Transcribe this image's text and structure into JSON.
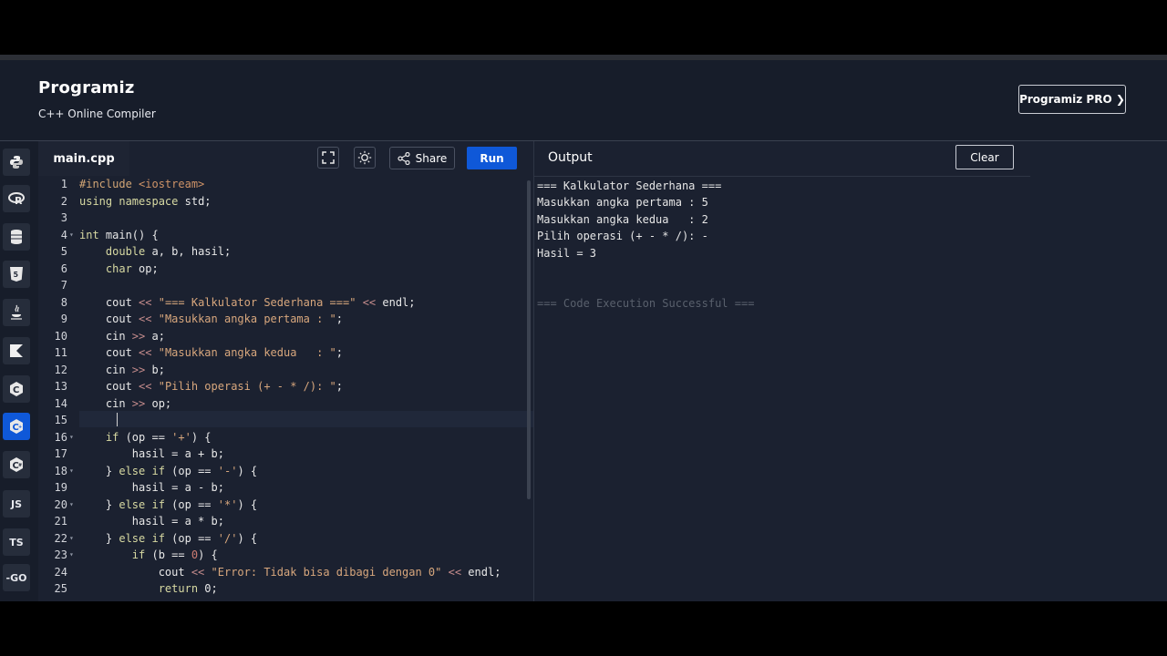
{
  "header": {
    "logo": "Programiz",
    "subtitle": "C++ Online Compiler",
    "pro_button": "Programiz PRO ❯"
  },
  "sidebar": {
    "languages": [
      {
        "name": "python-icon",
        "label": ""
      },
      {
        "name": "r-icon",
        "label": ""
      },
      {
        "name": "sql-icon",
        "label": ""
      },
      {
        "name": "html-icon",
        "label": ""
      },
      {
        "name": "java-icon",
        "label": ""
      },
      {
        "name": "kotlin-icon",
        "label": ""
      },
      {
        "name": "c-icon",
        "label": ""
      },
      {
        "name": "cpp-icon",
        "label": ""
      },
      {
        "name": "csharp-icon",
        "label": ""
      },
      {
        "name": "javascript-icon",
        "label": "JS"
      },
      {
        "name": "typescript-icon",
        "label": "TS"
      },
      {
        "name": "go-icon",
        "label": "-GO"
      }
    ]
  },
  "editor": {
    "file_name": "main.cpp",
    "share_label": "Share",
    "run_label": "Run",
    "lines": [
      "#include <iostream>",
      "using namespace std;",
      "",
      "int main() {",
      "    double a, b, hasil;",
      "    char op;",
      "",
      "    cout << \"=== Kalkulator Sederhana ===\" << endl;",
      "    cout << \"Masukkan angka pertama : \";",
      "    cin >> a;",
      "    cout << \"Masukkan angka kedua   : \";",
      "    cin >> b;",
      "    cout << \"Pilih operasi (+ - * /): \";",
      "    cin >> op;",
      "",
      "    if (op == '+') {",
      "        hasil = a + b;",
      "    } else if (op == '-') {",
      "        hasil = a - b;",
      "    } else if (op == '*') {",
      "        hasil = a * b;",
      "    } else if (op == '/') {",
      "        if (b == 0) {",
      "            cout << \"Error: Tidak bisa dibagi dengan 0\" << endl;",
      "            return 0;"
    ],
    "line_numbers": [
      "1",
      "2",
      "3",
      "4",
      "5",
      "6",
      "7",
      "8",
      "9",
      "10",
      "11",
      "12",
      "13",
      "14",
      "15",
      "16",
      "17",
      "18",
      "19",
      "20",
      "21",
      "22",
      "23",
      "24",
      "25"
    ]
  },
  "output": {
    "title": "Output",
    "clear_label": "Clear",
    "lines": [
      "=== Kalkulator Sederhana ===",
      "Masukkan angka pertama : 5",
      "Masukkan angka kedua   : 2",
      "Pilih operasi (+ - * /): -",
      "Hasil = 3",
      "",
      "",
      "=== Code Execution Successful ==="
    ]
  }
}
